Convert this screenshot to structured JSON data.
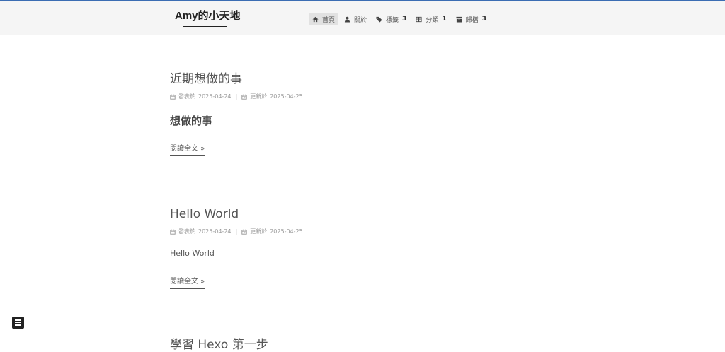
{
  "site": {
    "title": "Amy的小天地"
  },
  "nav": {
    "items": [
      {
        "label": "首頁",
        "icon": "home-icon",
        "badge": ""
      },
      {
        "label": "關於",
        "icon": "user-icon",
        "badge": ""
      },
      {
        "label": "標籤",
        "icon": "tags-icon",
        "badge": "3"
      },
      {
        "label": "分類",
        "icon": "grid-icon",
        "badge": "1"
      },
      {
        "label": "歸檔",
        "icon": "archive-icon",
        "badge": "3"
      }
    ]
  },
  "posts": [
    {
      "title": "近期想做的事",
      "posted_label": "發表於",
      "posted_date": "2025-04-24",
      "separator": "|",
      "updated_label": "更新於",
      "updated_date": "2025-04-25",
      "heading": "想做的事",
      "read_more": "閱讀全文 »"
    },
    {
      "title": "Hello World",
      "posted_label": "發表於",
      "posted_date": "2025-04-24",
      "separator": "|",
      "updated_label": "更新於",
      "updated_date": "2025-04-25",
      "excerpt": "Hello World",
      "read_more": "閱讀全文 »"
    },
    {
      "title": "學習 Hexo 第一步"
    }
  ],
  "colors": {
    "accent_line": "#3b6db3",
    "header_bg": "#f5f5f5",
    "active_nav_bg": "#e1e1e1"
  }
}
